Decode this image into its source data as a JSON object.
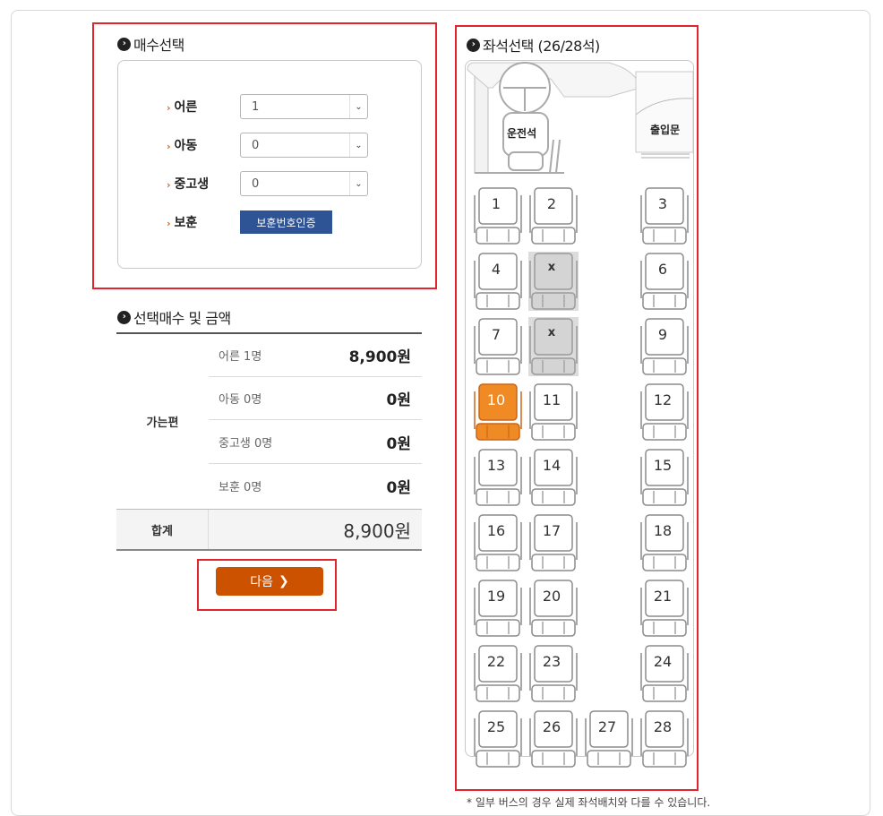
{
  "qty_section": {
    "title": "매수선택",
    "rows": [
      {
        "label": "어른",
        "value": "1"
      },
      {
        "label": "아동",
        "value": "0"
      },
      {
        "label": "중고생",
        "value": "0"
      }
    ],
    "veteran_label": "보훈",
    "veteran_button": "보훈번호인증"
  },
  "summary": {
    "title": "선택매수 및 금액",
    "direction": "가는편",
    "rows": [
      {
        "label": "어른 1명",
        "amount": "8,900원"
      },
      {
        "label": "아동 0명",
        "amount": "0원"
      },
      {
        "label": "중고생 0명",
        "amount": "0원"
      },
      {
        "label": "보훈 0명",
        "amount": "0원"
      }
    ],
    "total_label": "합계",
    "total_value": "8,900원",
    "next_label": "다음"
  },
  "seat_section": {
    "title": "좌석선택 (26/28석)",
    "driver": "운전석",
    "door": "출입문",
    "note": "* 일부 버스의 경우 실제 좌석배치와 다를 수 있습니다.",
    "seats": [
      {
        "label": "1",
        "state": "available"
      },
      {
        "label": "2",
        "state": "available"
      },
      {
        "label": "3",
        "state": "available"
      },
      {
        "label": "4",
        "state": "available"
      },
      {
        "label": "x",
        "state": "taken"
      },
      {
        "label": "6",
        "state": "available"
      },
      {
        "label": "7",
        "state": "available"
      },
      {
        "label": "x",
        "state": "taken"
      },
      {
        "label": "9",
        "state": "available"
      },
      {
        "label": "10",
        "state": "selected"
      },
      {
        "label": "11",
        "state": "available"
      },
      {
        "label": "12",
        "state": "available"
      },
      {
        "label": "13",
        "state": "available"
      },
      {
        "label": "14",
        "state": "available"
      },
      {
        "label": "15",
        "state": "available"
      },
      {
        "label": "16",
        "state": "available"
      },
      {
        "label": "17",
        "state": "available"
      },
      {
        "label": "18",
        "state": "available"
      },
      {
        "label": "19",
        "state": "available"
      },
      {
        "label": "20",
        "state": "available"
      },
      {
        "label": "21",
        "state": "available"
      },
      {
        "label": "22",
        "state": "available"
      },
      {
        "label": "23",
        "state": "available"
      },
      {
        "label": "24",
        "state": "available"
      },
      {
        "label": "25",
        "state": "available"
      },
      {
        "label": "26",
        "state": "available"
      },
      {
        "label": "27",
        "state": "available"
      },
      {
        "label": "28",
        "state": "available"
      }
    ]
  },
  "colors": {
    "highlight_border": "#e0262c",
    "selected_seat": "#f08a24",
    "taken_seat": "#d4d4d4",
    "next_button": "#cc5200",
    "veteran_button": "#2f5496"
  }
}
